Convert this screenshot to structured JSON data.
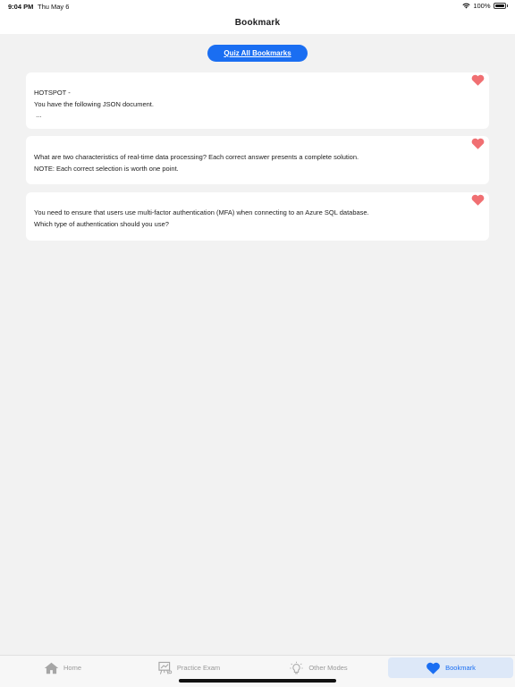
{
  "status_bar": {
    "time": "9:04 PM",
    "date": "Thu May 6",
    "battery": "100%"
  },
  "header": {
    "title": "Bookmark"
  },
  "quiz_button": {
    "label": "Quiz All Bookmarks"
  },
  "colors": {
    "accent": "#1a6ef2",
    "heart": "#f06f72",
    "background": "#f2f2f2"
  },
  "cards": [
    {
      "lines": [
        "HOTSPOT -",
        "You have the following JSON document.",
        " ..."
      ]
    },
    {
      "lines": [
        "What are two characteristics of real-time data processing? Each correct answer presents a complete solution.",
        "NOTE: Each correct selection is worth one point."
      ]
    },
    {
      "lines": [
        "You need to ensure that users use multi-factor authentication (MFA) when connecting to an Azure SQL database.",
        "Which type of authentication should you use?"
      ]
    }
  ],
  "tabs": [
    {
      "label": "Home",
      "icon": "home-icon"
    },
    {
      "label": "Practice Exam",
      "icon": "exam-board-icon"
    },
    {
      "label": "Other Modes",
      "icon": "lightbulb-icon"
    },
    {
      "label": "Bookmark",
      "icon": "heart-icon",
      "active": true
    }
  ]
}
